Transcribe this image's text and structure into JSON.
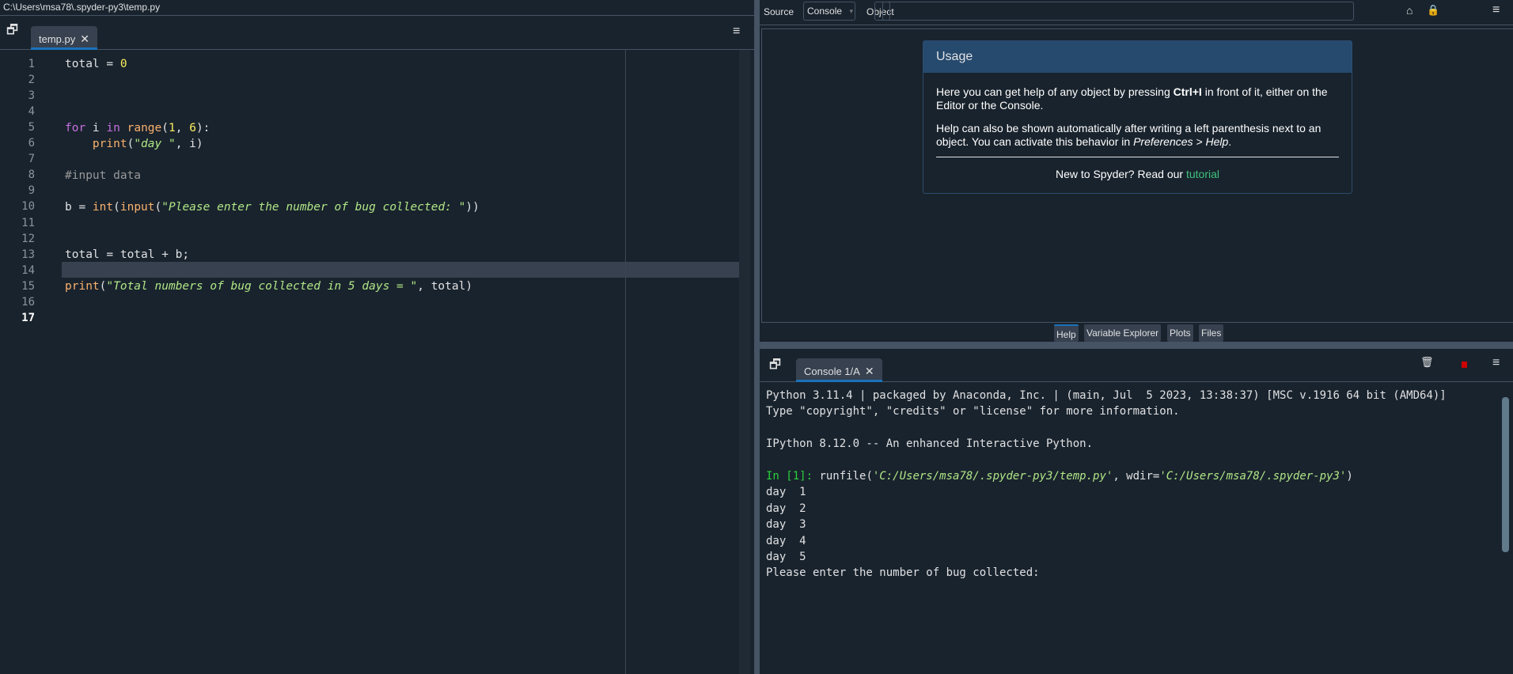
{
  "window": {
    "title": "C:\\Users\\msa78\\.spyder-py3\\temp.py"
  },
  "editor": {
    "tab": "temp.py",
    "lines": [
      "1",
      "2",
      "3",
      "4",
      "5",
      "6",
      "7",
      "8",
      "9",
      "10",
      "11",
      "12",
      "13",
      "14",
      "15",
      "16",
      "17"
    ],
    "current_line": "17",
    "code": {
      "l1a": "total = ",
      "l1b": "0",
      "l5a": "for",
      " l5b": " i ",
      "l5c": "in",
      "l5d": " ",
      "l5e": "range",
      "l5f": "(",
      "l5g": "1",
      ", ": "",
      "l5h": ", ",
      "l5i": "6",
      "l5j": "):",
      "l6a": "    ",
      "l6b": "print",
      "l6c": "(",
      "l6d": "\"day \"",
      "l6e": ", i)",
      "l8": "#input data",
      "l10a": "b = ",
      "l10b": "int",
      "l10c": "(",
      "l10d": "input",
      "l10e": "(",
      "l10f": "\"Please enter the number of bug collected: \"",
      "l10g": "))",
      "l13": "total = total + b;",
      "l15a": "print",
      "l15b": "(",
      "l15c": "\"Total numbers of bug collected in 5 days = \"",
      "l15d": ", total)"
    }
  },
  "help": {
    "source_label": "Source",
    "source_value": "Console",
    "object_label": "Object",
    "object_value": "",
    "usage_title": "Usage",
    "p1a": "Here you can get help of any object by pressing ",
    "p1b": "Ctrl+I",
    "p1c": " in front of it, either on the Editor or the Console.",
    "p2a": "Help can also be shown automatically after writing a left parenthesis next to an object. You can activate this behavior in ",
    "p2b": "Preferences > Help",
    ".": "",
    "p2c": ".",
    "p3a": "New to Spyder? Read our ",
    "p3b": "tutorial"
  },
  "pane_tabs": [
    "Help",
    "Variable Explorer",
    "Plots",
    "Files"
  ],
  "console": {
    "tab": "Console 1/A",
    "l1": "Python 3.11.4 | packaged by Anaconda, Inc. | (main, Jul  5 2023, 13:38:37) [MSC v.1916 64 bit (AMD64)]",
    "l2": "Type \"copyright\", \"credits\" or \"license\" for more information.",
    "l3": "IPython 8.12.0 -- An enhanced Interactive Python.",
    "prompt": "In [1]:",
    "cmd_a": " runfile(",
    "cmd_b": "'C:/Users/msa78/.spyder-py3/temp.py'",
    "cmd_c": ", wdir=",
    "cmd_d": "'C:/Users/msa78/.spyder-py3'",
    "cmd_e": ")",
    "out": [
      "day  1",
      "day  2",
      "day  3",
      "day  4",
      "day  5"
    ],
    "input_prompt": "Please enter the number of bug collected: "
  }
}
